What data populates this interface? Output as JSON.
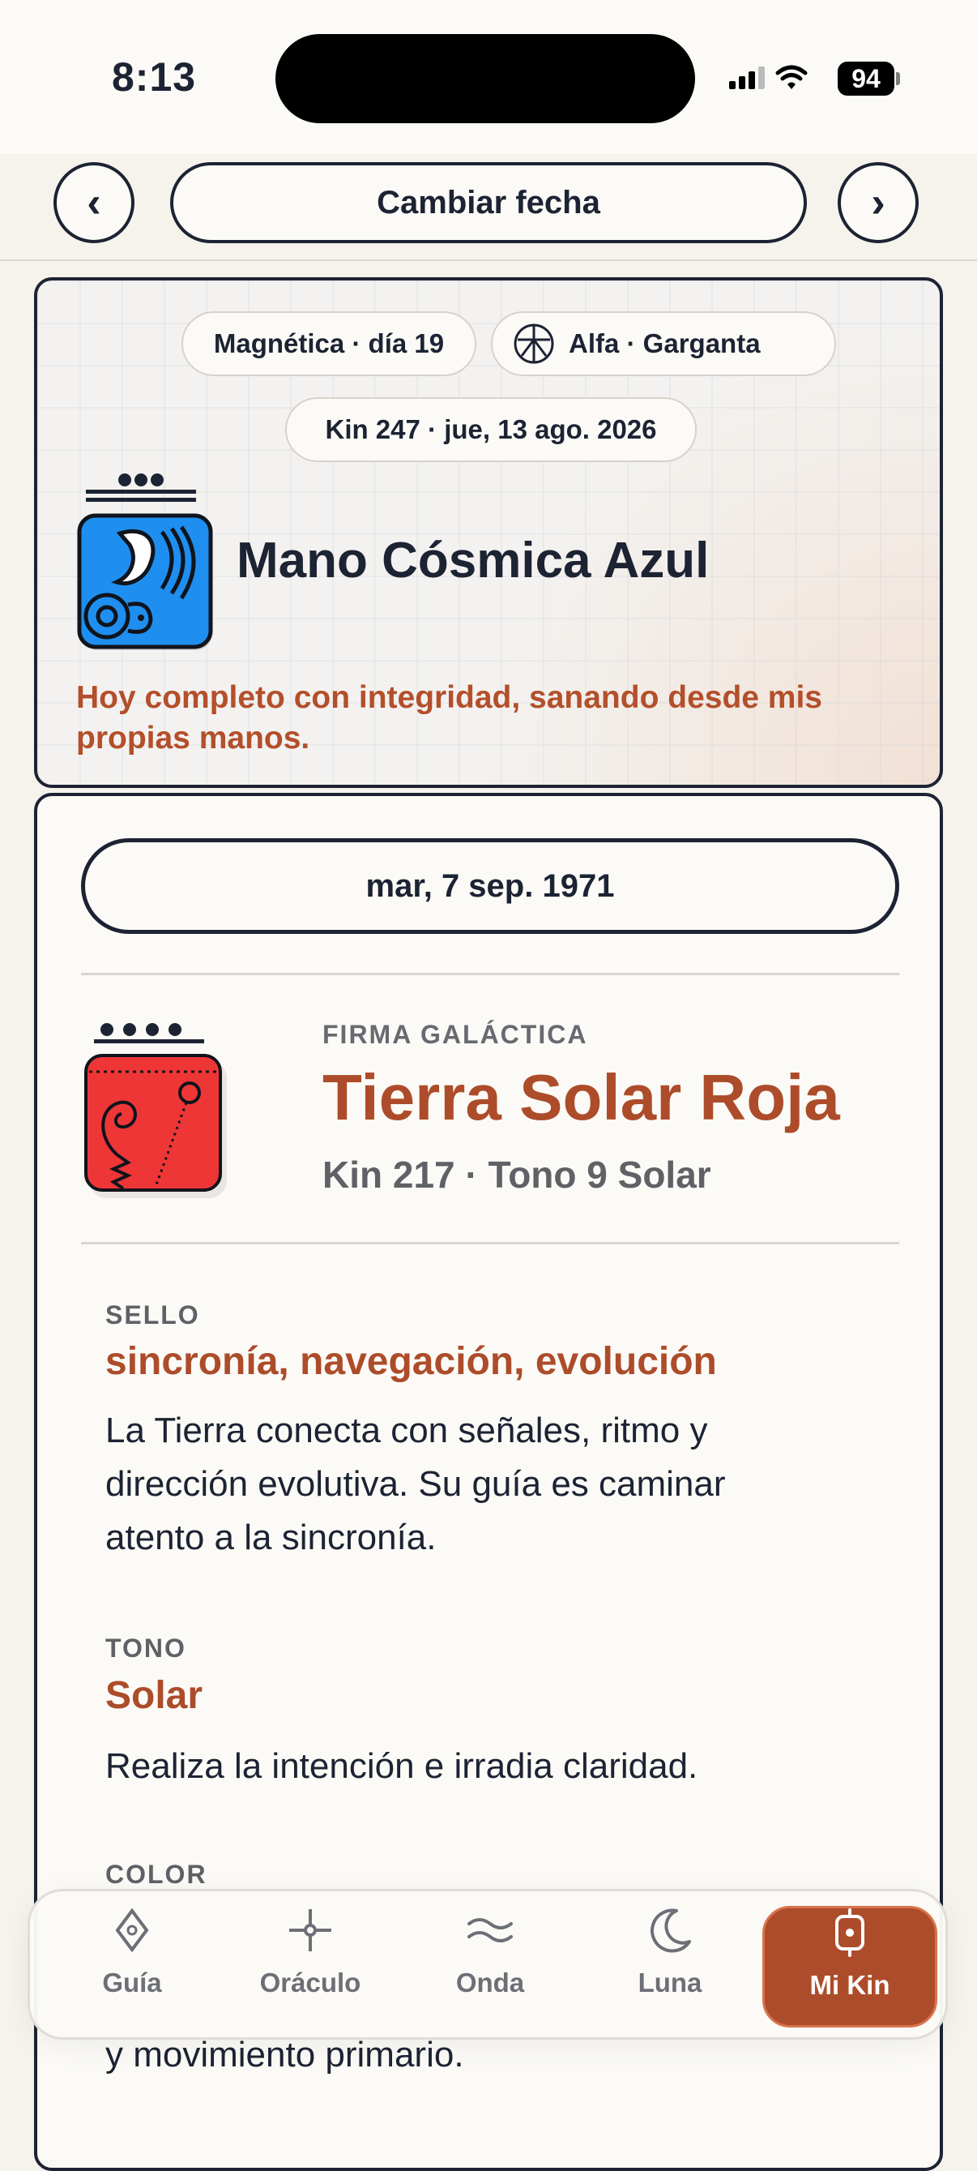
{
  "status_bar": {
    "time": "8:13",
    "battery": "94"
  },
  "nav": {
    "prev_icon": "‹",
    "next_icon": "›",
    "change_date_label": "Cambiar fecha"
  },
  "today": {
    "wave_chip": "Magnética · día 19",
    "plasma_chip": "Alfa · Garganta",
    "kin_chip": "Kin 247 · jue, 13 ago. 2026",
    "title": "Mano Cósmica Azul",
    "affirmation": "Hoy completo con integridad, sanando desde mis propias manos.",
    "seal_color": "#1e8ff0"
  },
  "birth": {
    "date": "mar, 7 sep. 1971",
    "label": "FIRMA GALÁCTICA",
    "title": "Tierra Solar Roja",
    "subtitle": "Kin 217 · Tono 9 Solar",
    "seal_color": "#ef3636",
    "sections": [
      {
        "label": "SELLO",
        "title": "sincronía, navegación, evolución",
        "body": "La Tierra conecta con señales, ritmo y dirección evolutiva. Su guía es caminar atento a la sincronía."
      },
      {
        "label": "TONO",
        "title": "Solar",
        "body": "Realiza la intención e irradia claridad."
      },
      {
        "label": "COLOR",
        "title": "",
        "body": "y movimiento primario."
      }
    ]
  },
  "tabs": [
    {
      "label": "Guía",
      "icon": "diamond-icon"
    },
    {
      "label": "Oráculo",
      "icon": "crosshair-icon"
    },
    {
      "label": "Onda",
      "icon": "wave-icon"
    },
    {
      "label": "Luna",
      "icon": "moon-icon"
    },
    {
      "label": "Mi Kin",
      "icon": "kin-icon"
    }
  ],
  "accent_color": "#ad4c2a"
}
